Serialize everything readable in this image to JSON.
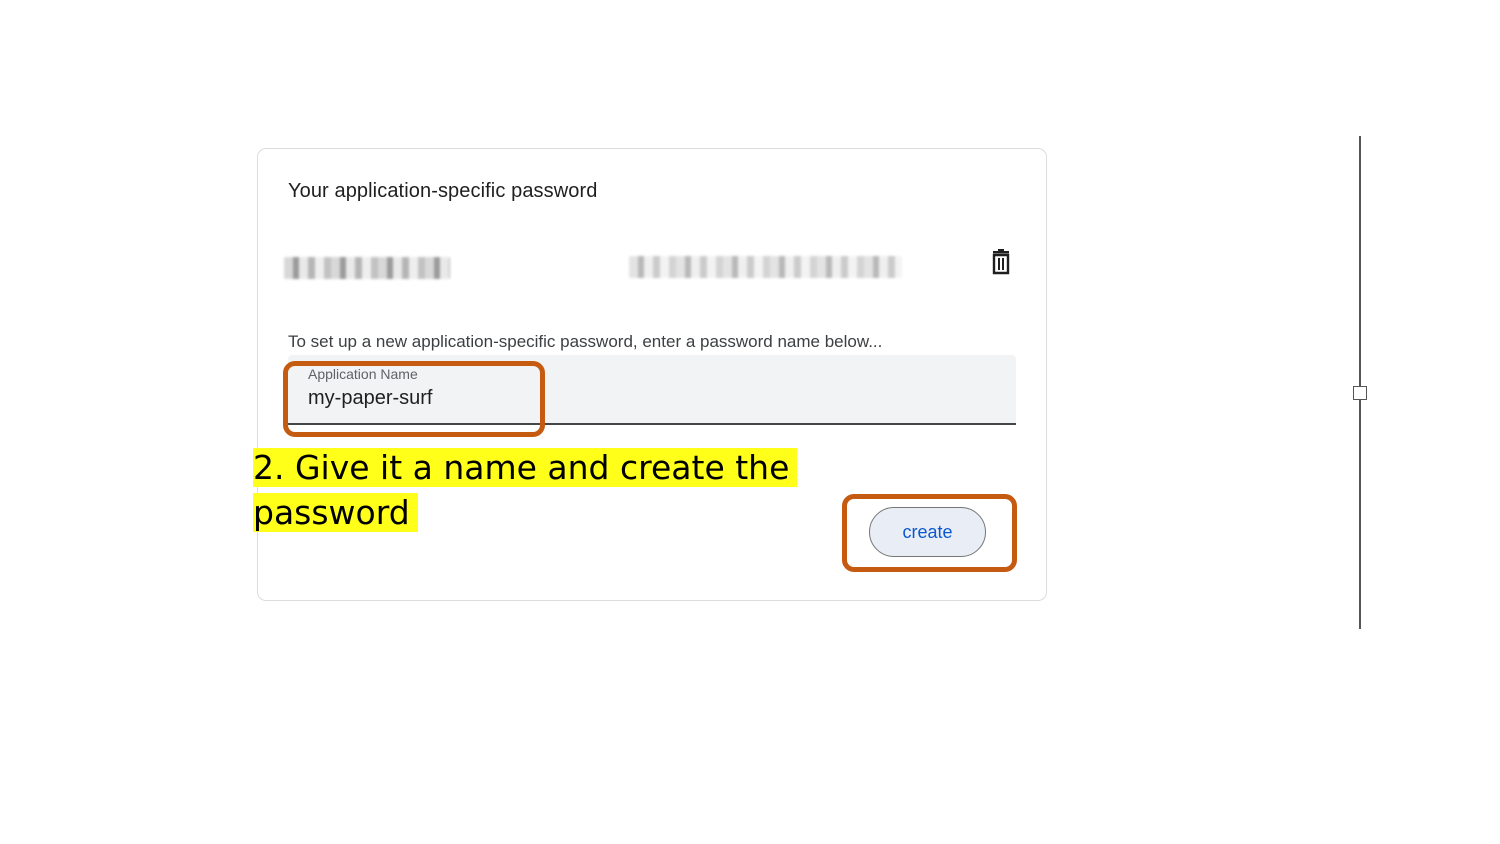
{
  "card": {
    "title": "Your application-specific password",
    "description": "To set up a new application-specific password, enter a password name below...",
    "existing_password": {
      "name_redacted": true,
      "value_redacted": true,
      "delete_icon": "trash-icon"
    },
    "field": {
      "label": "Application Name",
      "value": "my-paper-surf"
    },
    "create_label": "create"
  },
  "callout": {
    "text": "2. Give it a name and create the password",
    "highlight_color": "#ffff1a"
  },
  "colors": {
    "annotation_box": "#c55a11",
    "button_text": "#0b57d0",
    "button_bg": "#e9eef6"
  }
}
